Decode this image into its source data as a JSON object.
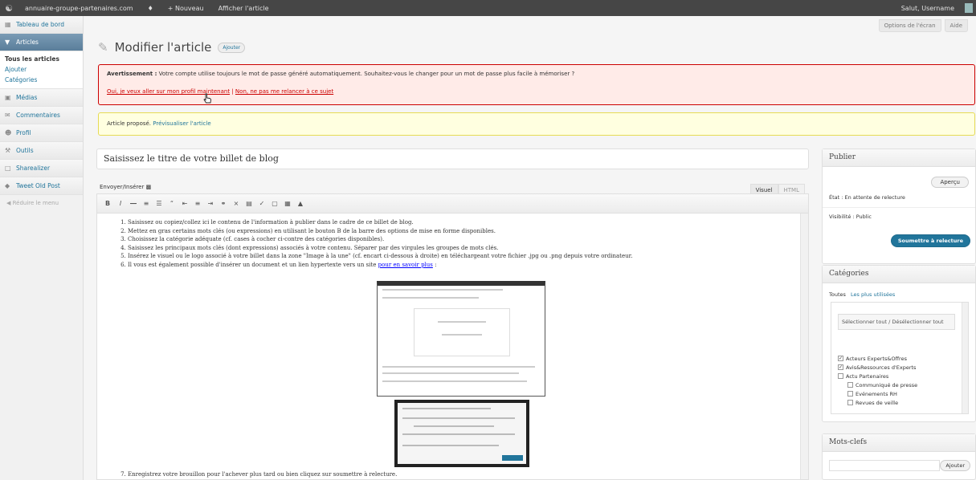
{
  "adminbar": {
    "site": "annuaire-groupe-partenaires.com",
    "new": "Nouveau",
    "view": "Afficher l'article",
    "user": "Salut, Username"
  },
  "sidebar": {
    "dashboard": "Tableau de bord",
    "articles": "Articles",
    "sub": [
      "Tous les articles",
      "Ajouter",
      "Catégories"
    ],
    "items": [
      "Médias",
      "Commentaires",
      "Profil",
      "Outils",
      "Sharealizer",
      "Tweet Old Post"
    ],
    "collapse": "Réduire le menu"
  },
  "screen_meta": {
    "options": "Options de l'écran",
    "help": "Aide"
  },
  "page": {
    "title": "Modifier l'article",
    "add_new": "Ajouter"
  },
  "notice_error": {
    "label": "Avertissement :",
    "text": "Votre compte utilise toujours le mot de passe généré automatiquement. Souhaitez-vous le changer pour un mot de passe plus facile à mémoriser ?",
    "link1": "Oui, je veux aller sur mon profil maintenant",
    "sep": "|",
    "link2": "Non, ne pas me relancer à ce sujet"
  },
  "notice_updated": {
    "text": "Article proposé.",
    "link": "Prévisualiser l'article"
  },
  "title_input": {
    "value": "Saisissez le titre de votre billet de blog"
  },
  "editor": {
    "upload": "Envoyer/Insérer",
    "tab_visual": "Visuel",
    "tab_html": "HTML",
    "list": [
      "Saisissez ou copiez/collez ici le contenu de l'information à publier dans le cadre de ce billet de blog.",
      "Mettez en gras certains mots clés (ou expressions) en utilisant le bouton B de la barre des options de mise en forme disponibles.",
      "Choisissez la catégorie adéquate (cf. cases à cocher ci-contre des catégories disponibles).",
      "Saisissez les principaux mots clés (dont expressions) associés à votre contenu. Séparer par des virgules les groupes de mots clés.",
      "Insérez le visuel ou le logo associé à votre billet dans la zone \"Image à la une\" (cf. encart ci-dessous à droite) en téléchargeant votre fichier .jpg ou .png depuis votre ordinateur.",
      "Il vous est également possible d'insérer un document et un lien hypertexte vers un site"
    ],
    "list_link": "pour en savoir plus",
    "list_end": " :",
    "last_item": "Enregistrez votre brouillon pour l'achever plus tard ou bien cliquez sur soumettre à relecture."
  },
  "publish": {
    "title": "Publier",
    "preview": "Aperçu",
    "status": "État : En attente de relecture",
    "visibility": "Visibilité : Public",
    "submit": "Soumettre à relecture"
  },
  "categories": {
    "title": "Catégories",
    "tab_all": "Toutes",
    "tab_popular": "Les plus utilisées",
    "select_all": "Sélectionner tout / Désélectionner tout",
    "items": [
      {
        "label": "Acteurs Experts&Offres",
        "checked": true,
        "level": 1
      },
      {
        "label": "Avis&Ressources d'Experts",
        "checked": true,
        "level": 1
      },
      {
        "label": "Actu Partenaires",
        "checked": false,
        "level": 1
      },
      {
        "label": "Communiqué de presse",
        "checked": false,
        "level": 2
      },
      {
        "label": "Evénements RH",
        "checked": false,
        "level": 2
      },
      {
        "label": "Revues de veille",
        "checked": false,
        "level": 2
      }
    ]
  },
  "tags": {
    "title": "Mots-clefs",
    "add": "Ajouter"
  }
}
